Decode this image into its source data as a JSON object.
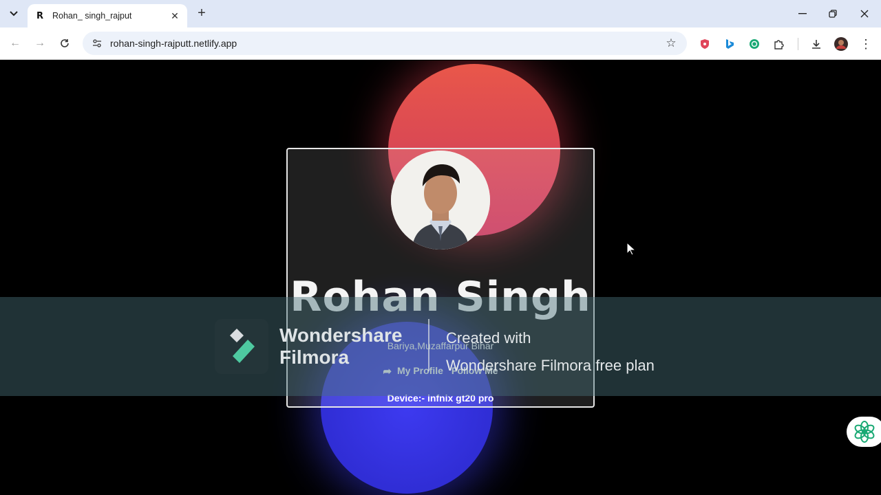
{
  "browser": {
    "tab_title": "Rohan_ singh_rajput",
    "favicon_letter": "R",
    "url": "rohan-singh-rajputt.netlify.app"
  },
  "profile": {
    "name": "Rohan Singh",
    "location": "Bariya,Muzaffarpur Bihar",
    "my_profile_label": "My Profile",
    "follow_label": "Follow Me",
    "device": "Device:- infnix gt20 pro"
  },
  "watermark": {
    "brand_line1": "Wondershare",
    "brand_line2": "Filmora",
    "created_line1": "Created with",
    "created_line2": "Wondershare Filmora free plan"
  },
  "colors": {
    "accent_red": "#e9574a",
    "accent_blue": "#3d3af0",
    "filmora_green": "#4ec9a0"
  }
}
